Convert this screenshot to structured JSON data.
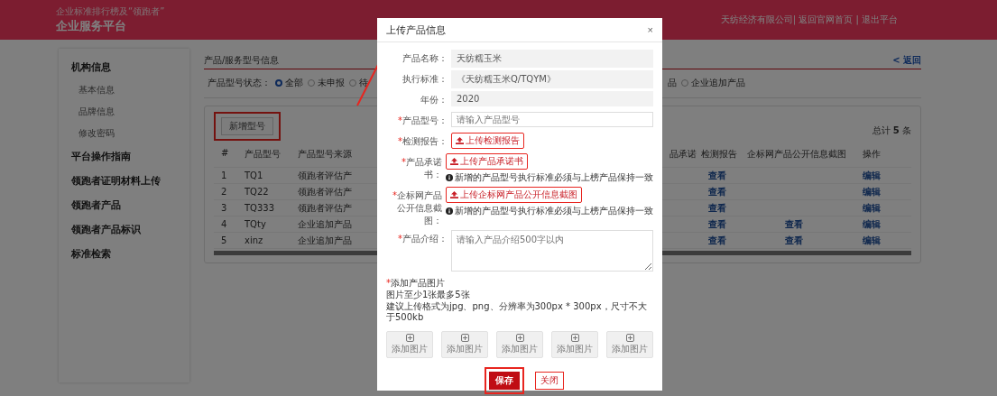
{
  "header": {
    "subtitle": "企业标准排行榜及“领跑者”",
    "title": "企业服务平台",
    "account_links": "天纺经济有限公司| 返回官网首页 | 退出平台"
  },
  "sidebar": {
    "sections": [
      {
        "label": "机构信息",
        "children": [
          {
            "label": "基本信息"
          },
          {
            "label": "品牌信息"
          },
          {
            "label": "修改密码"
          }
        ]
      },
      {
        "label": "平台操作指南"
      },
      {
        "label": "领跑者证明材料上传"
      },
      {
        "label": "领跑者产品"
      },
      {
        "label": "领跑者产品标识"
      },
      {
        "label": "标准检索"
      }
    ]
  },
  "content": {
    "title": "产品/服务型号信息",
    "back_link": "< 返回",
    "status_filter": {
      "label": "产品型号状态：",
      "options": [
        {
          "kind": "radio",
          "label": "全部",
          "selected": true
        },
        {
          "kind": "radio",
          "label": "未申报",
          "selected": false
        },
        {
          "kind": "radio",
          "label": "待",
          "selected": false
        },
        {
          "kind": "fragment",
          "label": "品"
        },
        {
          "kind": "radio",
          "label": "企业追加产品",
          "selected": false
        }
      ]
    },
    "add_button": "新增型号",
    "total": "总计 **5** 条",
    "table": {
      "columns": [
        "#",
        "产品型号",
        "产品型号来源",
        "品承诺",
        "检测报告",
        "企标网产品公开信息截图",
        "操作"
      ],
      "rows": [
        {
          "index": "1",
          "model": "TQ1",
          "source": "领跑者评估产",
          "report": "查看",
          "action": "编辑"
        },
        {
          "index": "2",
          "model": "TQ22",
          "source": "领跑者评估产",
          "report": "查看",
          "action": "编辑"
        },
        {
          "index": "3",
          "model": "TQ333",
          "source": "领跑者评估产",
          "report": "查看",
          "action": "编辑"
        },
        {
          "index": "4",
          "model": "TQty",
          "source": "企业追加产品",
          "report": "查看",
          "screenshot": "查看",
          "action": "编辑"
        },
        {
          "index": "5",
          "model": "xinz",
          "source": "企业追加产品",
          "report": "查看",
          "screenshot": "查看",
          "action": "编辑"
        }
      ]
    }
  },
  "modal": {
    "title": "上传产品信息",
    "close": "×",
    "fields": [
      {
        "kind": "readonly",
        "label": "产品名称：",
        "value": "天纺糯玉米"
      },
      {
        "kind": "readonly",
        "label": "执行标准：",
        "value": "《天纺糯玉米Q/TQYM》"
      },
      {
        "kind": "readonly",
        "label": "年份：",
        "value": "2020"
      },
      {
        "kind": "input",
        "required_mark": "*",
        "label": "产品型号：",
        "placeholder": "请输入产品型号"
      },
      {
        "kind": "upload",
        "required_mark": "*",
        "label": "检测报告：",
        "button": "上传检测报告"
      },
      {
        "kind": "upload",
        "required_mark": "*",
        "label": "产品承诺书：",
        "button": "上传产品承诺书",
        "hint": "新增的产品型号执行标准必须与上榜产品保持一致"
      },
      {
        "kind": "upload",
        "required_mark": "*",
        "label": "企标网产品公开信息截图：",
        "button": "上传企标网产品公开信息截图",
        "hint": "新增的产品型号执行标准必须与上榜产品保持一致"
      },
      {
        "kind": "textarea",
        "required_mark": "*",
        "label": "产品介绍：",
        "placeholder": "请输入产品介绍500字以内"
      }
    ],
    "images": {
      "required_mark": "*",
      "title": "添加产品图片",
      "notes": [
        "图片至少1张最多5张",
        "建议上传格式为jpg、png、分辨率为300px * 300px，尺寸不大于500kb"
      ],
      "tiles": [
        "添加图片",
        "添加图片",
        "添加图片",
        "添加图片",
        "添加图片"
      ]
    },
    "save_button": "保存",
    "close_button": "关闭"
  }
}
